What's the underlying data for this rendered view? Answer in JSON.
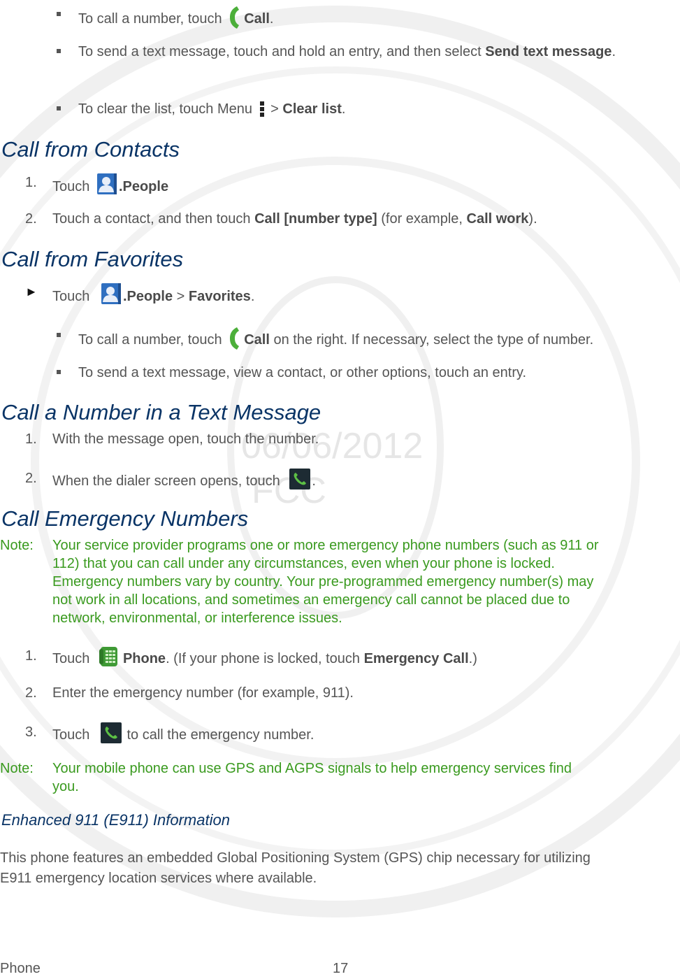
{
  "watermark": {
    "date": "06/06/2012",
    "agency": "FCC"
  },
  "sections": {
    "recent_calls_bullets": {
      "b1": {
        "pre": "To call a number, touch ",
        "bold": "Call",
        "post": ".",
        "icon": "green-handset-icon"
      },
      "b2": {
        "pre": "To send a text message, touch and hold an entry, and then select ",
        "bold": "Send text message",
        "post": "."
      },
      "b3": {
        "pre": "To clear the list, touch Menu ",
        "icon": "menu-dots-icon",
        "sep": " > ",
        "bold": "Clear list",
        "post": "."
      }
    },
    "call_from_contacts": {
      "heading": "Call from Contacts",
      "step1": {
        "num": "1.",
        "pre": "Touch ",
        "icon": "people-app-icon",
        "bold": ".People"
      },
      "step2": {
        "num": "2.",
        "pre": "Touch a contact, and then touch ",
        "bold1": "Call [number type]",
        "mid": " (for example, ",
        "bold2": "Call work",
        "post": ")."
      }
    },
    "call_from_favorites": {
      "heading": "Call from Favorites",
      "arrow": "►",
      "step": {
        "pre": "Touch ",
        "icon": "people-app-icon",
        "bold1": ".People",
        "sep": " > ",
        "bold2": "Favorites",
        "post": "."
      },
      "b1": {
        "pre": "To call a number, touch ",
        "icon": "green-handset-icon",
        "bold": "Call",
        "post": " on the right. If necessary, select the type of number."
      },
      "b2": {
        "text": "To send a text message, view a contact, or other options, touch an entry."
      }
    },
    "call_number_in_text": {
      "heading": "Call a Number in a Text Message",
      "step1": {
        "num": "1.",
        "text": "With the message open, touch the number."
      },
      "step2": {
        "num": "2.",
        "pre": "When the dialer screen opens, touch ",
        "icon": "dial-button-icon",
        "post": "."
      }
    },
    "call_emergency": {
      "heading": "Call Emergency Numbers",
      "note1": {
        "label": "Note:",
        "lines": [
          "Your service provider programs one or more emergency phone numbers (such as 911 or",
          "112) that you can call under any circumstances, even when your phone is locked.",
          "Emergency numbers vary by country. Your pre-programmed emergency number(s) may",
          "not work in all locations, and sometimes an emergency call cannot be placed due to",
          "network, environmental, or interference issues."
        ]
      },
      "step1": {
        "num": "1.",
        "pre": "Touch ",
        "icon": "phone-app-icon",
        "bold1": "Phone",
        "mid": ". (If your phone is locked, touch ",
        "bold2": "Emergency Call",
        "post": ".)"
      },
      "step2": {
        "num": "2.",
        "text": "Enter the emergency number (for example, 911)."
      },
      "step3": {
        "num": "3.",
        "pre": "Touch ",
        "icon": "dial-button-icon",
        "post": " to call the emergency number."
      },
      "note2": {
        "label": "Note:",
        "lines": [
          "Your mobile phone can use GPS and AGPS signals to help emergency services find",
          "you."
        ]
      }
    },
    "e911": {
      "heading": "Enhanced 911 (E911) Information",
      "lines": [
        "This phone features an embedded Global Positioning System (GPS) chip necessary for utilizing",
        "E911 emergency location services where available."
      ]
    }
  },
  "footer": {
    "section": "Phone",
    "page": "17"
  },
  "colors": {
    "heading": "#0a3466",
    "note": "#3a9a1f",
    "body": "#555555",
    "icon_green": "#4caf3a",
    "people_blue": "#2f6fc0"
  }
}
